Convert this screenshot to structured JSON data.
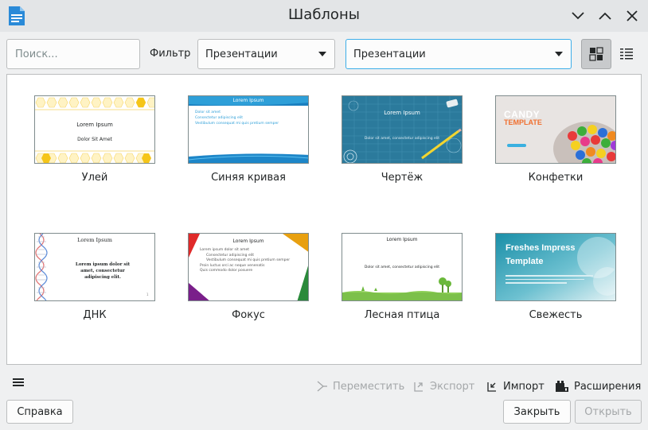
{
  "window": {
    "title": "Шаблоны"
  },
  "toolbar": {
    "search_placeholder": "Поиск...",
    "filter_label": "Фильтр",
    "filter_type": "Презентации",
    "category": "Презентации"
  },
  "templates": [
    {
      "label": "Улей",
      "thumb_text": [
        "Lorem Ipsum",
        "Dolor Sit Amet"
      ]
    },
    {
      "label": "Синяя кривая",
      "thumb_text": [
        "Lorem Ipsum",
        "Dolor sit amet",
        "Consectetur adipiscing elit",
        "Vestibulum consequat mi quis pretium semper"
      ]
    },
    {
      "label": "Чертёж",
      "thumb_text": [
        "Lorem Ipsum",
        "Dolor sit amet, consectetur adipiscing elit"
      ]
    },
    {
      "label": "Конфетки",
      "thumb_text": [
        "CANDY",
        "TEMPLATE"
      ]
    },
    {
      "label": "ДНК",
      "thumb_text": [
        "Lorem Ipsum",
        "Lorem ipsum dolor sit amet, consectetur adipiscing elit."
      ]
    },
    {
      "label": "Фокус",
      "thumb_text": [
        "Lorem Ipsum",
        "Lorem ipsum dolor sit amet",
        "Consectetur adipiscing elit",
        "Vestibulum consequat mi quis pretium semper",
        "Proin luctus orci ac neque venenatis",
        "Quis commodo dolor posuere"
      ]
    },
    {
      "label": "Лесная птица",
      "thumb_text": [
        "Lorem Ipsum",
        "Dolor sit amet, consectetur adipiscing elit"
      ]
    },
    {
      "label": "Свежесть",
      "thumb_text": [
        "Freshes Impress",
        "Template"
      ]
    }
  ],
  "actions": {
    "move": "Переместить",
    "export": "Экспорт",
    "import": "Импорт",
    "extensions": "Расширения"
  },
  "buttons": {
    "help": "Справка",
    "close": "Закрыть",
    "open": "Открыть"
  },
  "colors": {
    "accent": "#3daee9",
    "disabled_text": "#a4a7a9"
  },
  "icons": {
    "app": "libreoffice-document-icon",
    "minimize": "chevron-down-icon",
    "maximize": "chevron-up-icon",
    "close": "close-icon",
    "thumbnail_view": "grid-view-icon",
    "list_view": "list-view-icon",
    "menu": "hamburger-menu-icon",
    "move": "move-icon",
    "export": "export-icon",
    "import": "import-icon",
    "extensions": "extensions-icon"
  }
}
